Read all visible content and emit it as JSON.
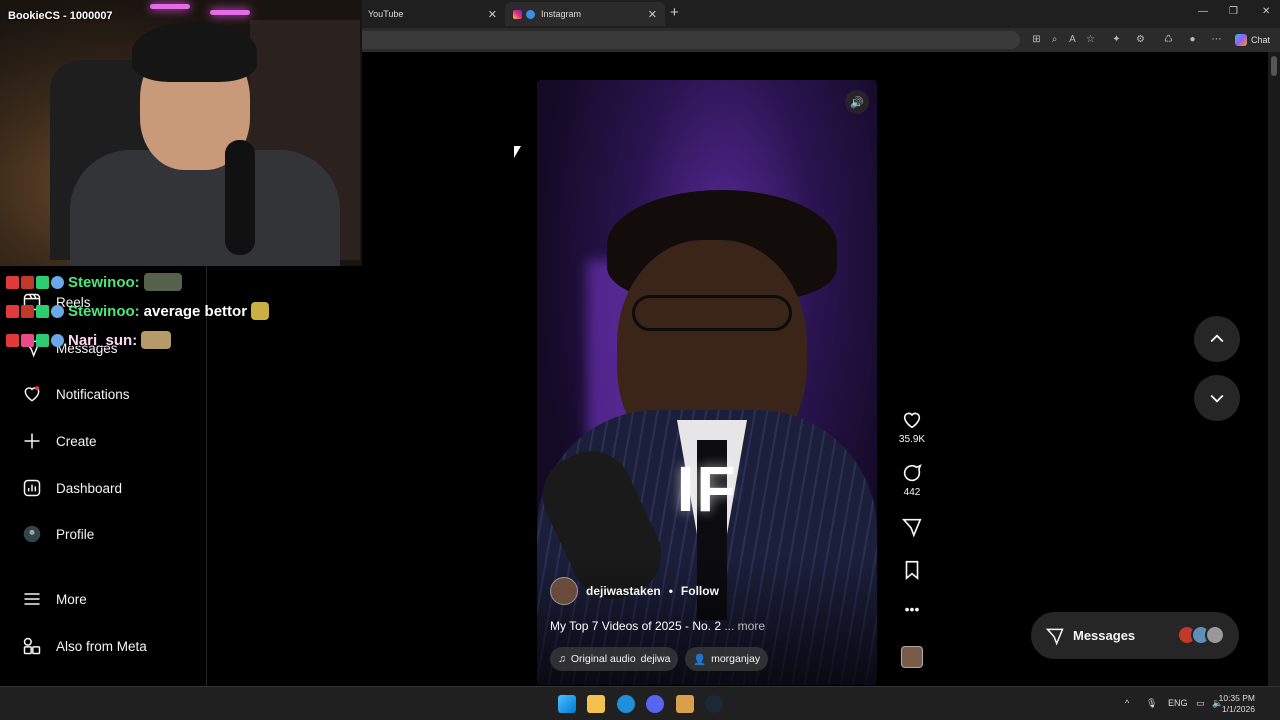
{
  "browser": {
    "tabs": [
      {
        "label": "YouTube"
      },
      {
        "label": "Instagram"
      }
    ],
    "new_tab_icon": "plus-icon",
    "chat_button": "Chat"
  },
  "stream": {
    "streamer_name": "BookieCS - 1000007",
    "chat": [
      {
        "user": "Stewinoo:",
        "message": "",
        "color": "#4ee67a"
      },
      {
        "user": "Stewinoo:",
        "message": "average bettor",
        "color": "#4ee67a"
      },
      {
        "user": "Nari_sun:",
        "message": "",
        "color": "#ffd7f0"
      }
    ]
  },
  "sidebar": {
    "items": [
      {
        "label": "Reels",
        "icon": "reels-icon"
      },
      {
        "label": "Messages",
        "icon": "messages-icon"
      },
      {
        "label": "Notifications",
        "icon": "heart-icon"
      },
      {
        "label": "Create",
        "icon": "plus-icon"
      },
      {
        "label": "Dashboard",
        "icon": "dashboard-icon"
      },
      {
        "label": "Profile",
        "icon": "avatar"
      },
      {
        "label": "More",
        "icon": "menu-icon"
      },
      {
        "label": "Also from Meta",
        "icon": "meta-apps-icon"
      }
    ]
  },
  "reel": {
    "overlay_word": "IF",
    "author": "dejiwastaken",
    "separator": "•",
    "follow_label": "Follow",
    "caption": "My Top 7 Videos of 2025 - No. 2",
    "caption_more": "... more",
    "audio_label": "Original audio",
    "audio_author": "dejiwa",
    "tagged_user": "morganjay",
    "likes": "35.9K",
    "comments": "442"
  },
  "messages_pill": {
    "label": "Messages"
  },
  "taskbar": {
    "language": "ENG",
    "time": "10:35 PM",
    "date": "1/1/2026"
  }
}
